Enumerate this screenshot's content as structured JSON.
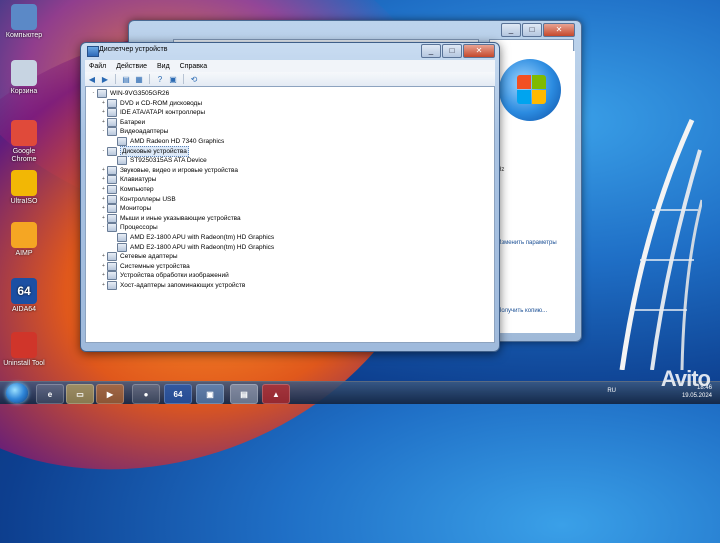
{
  "desktop": {
    "icons": [
      {
        "label": "Компьютер",
        "icon": "computer-icon"
      },
      {
        "label": "Корзина",
        "icon": "recycle-bin-icon"
      },
      {
        "label": "Google Chrome",
        "icon": "chrome-icon"
      },
      {
        "label": "UltraISO",
        "icon": "disc-icon"
      },
      {
        "label": "AIMP",
        "icon": "aimp-icon"
      },
      {
        "label": "AIDA64",
        "icon": "aida64-icon",
        "glyph": "64"
      },
      {
        "label": "Uninstall Tool",
        "icon": "uninstall-tool-icon"
      }
    ]
  },
  "back_window": {
    "side_text_1": "Hz",
    "side_link_1": "Изменить параметры",
    "side_link_2": "Получить копию..."
  },
  "device_manager": {
    "title": "Диспетчер устройств",
    "menu": [
      "Файл",
      "Действие",
      "Вид",
      "Справка"
    ],
    "tree": [
      {
        "label": "WIN-9VG3505GR26",
        "level": 0,
        "expander": "-"
      },
      {
        "label": "DVD и CD-ROM дисководы",
        "level": 1,
        "expander": "+"
      },
      {
        "label": "IDE ATA/ATAPI контроллеры",
        "level": 1,
        "expander": "+"
      },
      {
        "label": "Батареи",
        "level": 1,
        "expander": "+"
      },
      {
        "label": "Видеоадаптеры",
        "level": 1,
        "expander": "-"
      },
      {
        "label": "AMD Radeon HD 7340 Graphics",
        "level": 2,
        "expander": ""
      },
      {
        "label": "Дисковые устройства",
        "level": 1,
        "expander": "-",
        "selected": true
      },
      {
        "label": "ST9250315AS ATA Device",
        "level": 2,
        "expander": ""
      },
      {
        "label": "Звуковые, видео и игровые устройства",
        "level": 1,
        "expander": "+"
      },
      {
        "label": "Клавиатуры",
        "level": 1,
        "expander": "+"
      },
      {
        "label": "Компьютер",
        "level": 1,
        "expander": "+"
      },
      {
        "label": "Контроллеры USB",
        "level": 1,
        "expander": "+"
      },
      {
        "label": "Мониторы",
        "level": 1,
        "expander": "+"
      },
      {
        "label": "Мыши и иные указывающие устройства",
        "level": 1,
        "expander": "+"
      },
      {
        "label": "Процессоры",
        "level": 1,
        "expander": "-"
      },
      {
        "label": "AMD E2-1800 APU with Radeon(tm) HD Graphics",
        "level": 2,
        "expander": ""
      },
      {
        "label": "AMD E2-1800 APU with Radeon(tm) HD Graphics",
        "level": 2,
        "expander": ""
      },
      {
        "label": "Сетевые адаптеры",
        "level": 1,
        "expander": "+"
      },
      {
        "label": "Системные устройства",
        "level": 1,
        "expander": "+"
      },
      {
        "label": "Устройства обработки изображений",
        "level": 1,
        "expander": "+"
      },
      {
        "label": "Хост-адаптеры запоминающих устройств",
        "level": 1,
        "expander": "+"
      }
    ]
  },
  "taskbar": {
    "language": "RU",
    "time": "18:46",
    "date": "19.05.2024",
    "items": [
      "ie-icon",
      "explorer-icon",
      "media-player-icon",
      "chrome-icon",
      "aida64-icon",
      "control-panel-icon",
      "device-manager-icon",
      "uninstall-tool-icon"
    ],
    "aida_glyph": "64"
  },
  "watermark": "Avito"
}
